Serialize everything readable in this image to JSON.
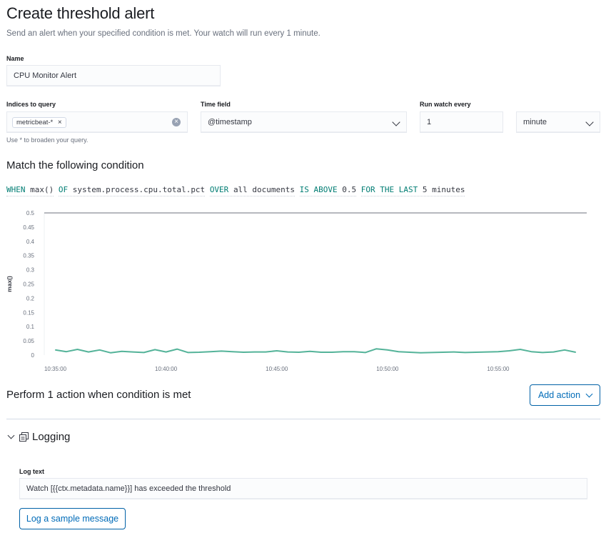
{
  "page": {
    "title": "Create threshold alert",
    "subtitle": "Send an alert when your specified condition is met. Your watch will run every 1 minute."
  },
  "name_field": {
    "label": "Name",
    "value": "CPU Monitor Alert"
  },
  "indices_field": {
    "label": "Indices to query",
    "chip": "metricbeat-*",
    "help": "Use * to broaden your query."
  },
  "time_field": {
    "label": "Time field",
    "value": "@timestamp"
  },
  "run_watch": {
    "label": "Run watch every",
    "value": "1",
    "unit": "minute"
  },
  "condition": {
    "title": "Match the following condition",
    "when": "WHEN",
    "agg": "max()",
    "of": "OF",
    "field": "system.process.cpu.total.pct",
    "over": "OVER",
    "over_value": "all documents",
    "is": "IS ABOVE",
    "threshold": "0.5",
    "for": "FOR THE LAST",
    "window": "5 minutes"
  },
  "chart_data": {
    "type": "line",
    "ylabel": "max()",
    "ylim": [
      0,
      0.5
    ],
    "yticks": [
      "0",
      "0.05",
      "0.1",
      "0.15",
      "0.2",
      "0.25",
      "0.3",
      "0.35",
      "0.4",
      "0.45",
      "0.5"
    ],
    "xticks": [
      "10:35:00",
      "10:40:00",
      "10:45:00",
      "10:50:00",
      "10:55:00"
    ],
    "xlim_minutes": [
      34.5,
      59.0
    ],
    "threshold": 0.5,
    "series_color": "#54b399",
    "threshold_color": "#8a8e96",
    "series": [
      {
        "x": [
          35.0,
          35.5,
          36.0,
          36.5,
          37.0,
          37.5,
          38.0,
          38.5,
          39.0,
          39.5,
          40.0,
          40.5,
          41.0,
          41.5,
          42.0,
          42.5,
          43.0,
          43.5,
          44.0,
          44.5,
          45.0,
          45.5,
          46.0,
          46.5,
          47.0,
          47.5,
          48.0,
          48.5,
          49.0,
          49.5,
          50.0,
          50.5,
          51.0,
          51.5,
          52.0,
          52.5,
          53.0,
          53.5,
          54.0,
          54.5,
          55.0,
          55.5,
          56.0,
          56.5,
          57.0,
          57.5,
          58.0,
          58.5
        ],
        "values": [
          0.018,
          0.012,
          0.02,
          0.011,
          0.018,
          0.008,
          0.013,
          0.011,
          0.009,
          0.019,
          0.011,
          0.021,
          0.009,
          0.01,
          0.012,
          0.014,
          0.012,
          0.01,
          0.011,
          0.011,
          0.015,
          0.011,
          0.01,
          0.013,
          0.01,
          0.01,
          0.012,
          0.012,
          0.009,
          0.022,
          0.018,
          0.012,
          0.01,
          0.008,
          0.009,
          0.01,
          0.011,
          0.009,
          0.01,
          0.011,
          0.012,
          0.015,
          0.02,
          0.012,
          0.009,
          0.011,
          0.018,
          0.01
        ]
      }
    ]
  },
  "actions": {
    "title": "Perform 1 action when condition is met",
    "add_button": "Add action"
  },
  "logging": {
    "title": "Logging",
    "log_label": "Log text",
    "log_value": "Watch [{{ctx.metadata.name}}] has exceeded the threshold",
    "sample_button": "Log a sample message"
  }
}
